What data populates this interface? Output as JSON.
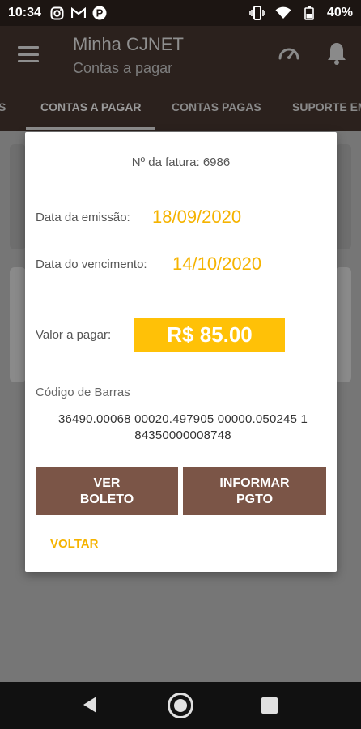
{
  "status_bar": {
    "time": "10:34",
    "battery_percent": "40%",
    "left_icons": [
      "instagram-icon",
      "gmail-icon",
      "p-app-icon"
    ],
    "right_icons": [
      "vibrate-icon",
      "wifi-icon",
      "battery-icon"
    ],
    "p_glyph": "P"
  },
  "app_bar": {
    "title": "Minha CJNET",
    "subtitle": "Contas a pagar"
  },
  "tabs": {
    "items": [
      {
        "label": "S"
      },
      {
        "label": "CONTAS A PAGAR"
      },
      {
        "label": "CONTAS PAGAS"
      },
      {
        "label": "SUPORTE EM"
      }
    ],
    "active_index": 1
  },
  "dialog": {
    "invoice_number": "Nº da fatura: 6986",
    "emission_label": "Data da emissão:",
    "emission_date": "18/09/2020",
    "due_label": "Data do vencimento:",
    "due_date": "14/10/2020",
    "amount_label": "Valor a pagar:",
    "amount": "R$ 85.00",
    "barcode_label": "Código de Barras",
    "barcode": "36490.00068 00020.497905 00000.050245 1 84350000008748",
    "view_boleto_button": "VER\nBOLETO",
    "inform_payment_button": "INFORMAR\nPGTO",
    "back_button": "VOLTAR"
  },
  "colors": {
    "accent_yellow": "#ffc107",
    "button_brown": "#7b5547",
    "appbar_dim": "#2b211d"
  }
}
